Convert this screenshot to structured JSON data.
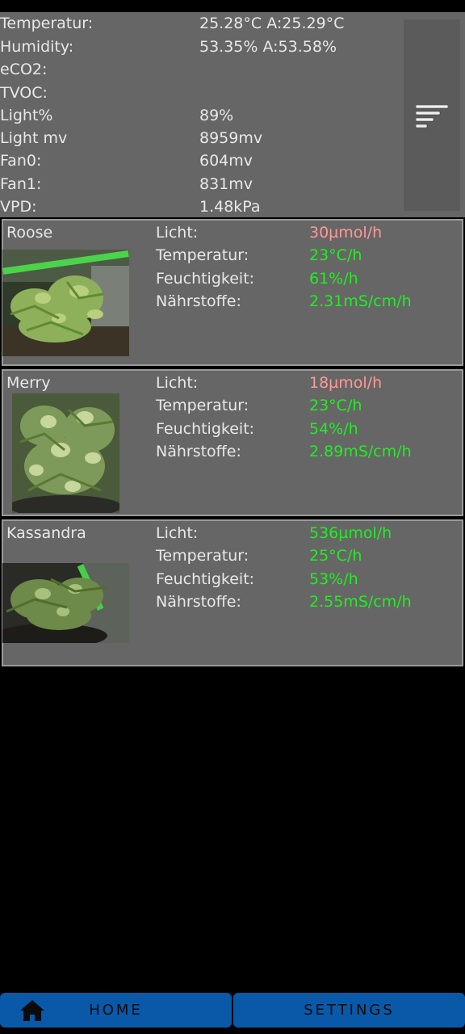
{
  "sensors": {
    "rows": [
      {
        "label": "Temperatur:",
        "value": "25.28°C A:25.29°C"
      },
      {
        "label": "Humidity:",
        "value": "53.35% A:53.58%"
      },
      {
        "label": "eCO2:",
        "value": ""
      },
      {
        "label": "TVOC:",
        "value": ""
      },
      {
        "label": "Light%",
        "value": "89%"
      },
      {
        "label": "Light mv",
        "value": "8959mv"
      },
      {
        "label": "Fan0:",
        "value": "604mv"
      },
      {
        "label": "Fan1:",
        "value": "831mv"
      },
      {
        "label": "VPD:",
        "value": "1.48kPa"
      }
    ],
    "menu_icon": "sort-icon"
  },
  "metric_labels": {
    "light": "Licht:",
    "temperature": "Temperatur:",
    "humidity": "Feuchtigkeit:",
    "nutrients": "Nährstoffe:"
  },
  "plants": [
    {
      "name": "Roose",
      "light": "30µmol/h",
      "temperature": "23°C/h",
      "humidity": "61%/h",
      "nutrients": "2.31mS/cm/h",
      "light_status_color": "#ff9999"
    },
    {
      "name": "Merry",
      "light": "18µmol/h",
      "temperature": "23°C/h",
      "humidity": "54%/h",
      "nutrients": "2.89mS/cm/h",
      "light_status_color": "#ff9999"
    },
    {
      "name": "Kassandra",
      "light": "536µmol/h",
      "temperature": "25°C/h",
      "humidity": "53%/h",
      "nutrients": "2.55mS/cm/h",
      "light_status_color": "#22ee22"
    }
  ],
  "colors": {
    "ok": "#22ee22",
    "warn": "#ff9999",
    "panel": "#666666",
    "nav": "#0a59a8"
  },
  "nav": {
    "home_label": "HOME",
    "settings_label": "SETTINGS",
    "home_icon": "home-icon"
  }
}
